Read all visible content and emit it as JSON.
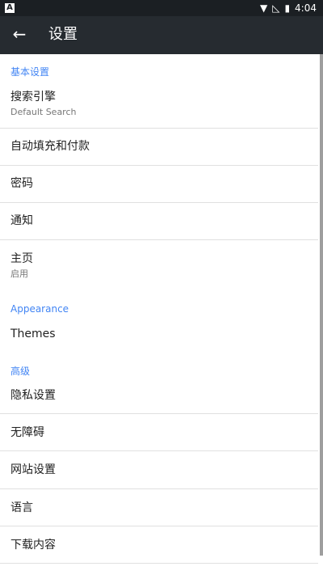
{
  "status_bar": {
    "time": "4:04",
    "icons": [
      "notification-a-icon",
      "wifi-icon",
      "no-signal-icon",
      "battery-icon"
    ]
  },
  "toolbar": {
    "back_icon": "arrow-back-icon",
    "title": "设置"
  },
  "sections": {
    "basic": "基本设置",
    "appearance": "Appearance",
    "advanced": "高级"
  },
  "items": {
    "search_engine": {
      "label": "搜索引擎",
      "summary": "Default Search"
    },
    "autofill": {
      "label": "自动填充和付款"
    },
    "passwords": {
      "label": "密码"
    },
    "notifications": {
      "label": "通知"
    },
    "homepage": {
      "label": "主页",
      "summary": "启用"
    },
    "themes": {
      "label": "Themes"
    },
    "privacy": {
      "label": "隐私设置"
    },
    "accessibility": {
      "label": "无障碍"
    },
    "site_settings": {
      "label": "网站设置"
    },
    "language": {
      "label": "语言"
    },
    "downloads": {
      "label": "下载内容"
    }
  }
}
